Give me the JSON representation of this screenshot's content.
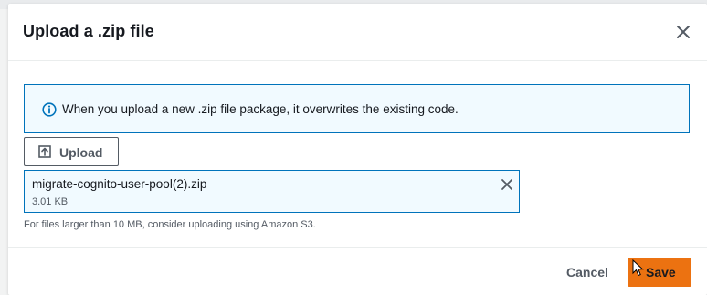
{
  "modal": {
    "title": "Upload a .zip file",
    "close_icon": "close-icon"
  },
  "alert": {
    "type": "info",
    "icon": "info-circle-icon",
    "text": "When you upload a new .zip file package, it overwrites the existing code."
  },
  "upload": {
    "icon": "upload-icon",
    "label": "Upload"
  },
  "file": {
    "name": "migrate-cognito-user-pool(2).zip",
    "size": "3.01 KB",
    "remove_icon": "close-icon"
  },
  "hint": "For files larger than 10 MB, consider uploading using Amazon S3.",
  "footer": {
    "cancel_label": "Cancel",
    "save_label": "Save"
  },
  "colors": {
    "primary_button": "#ec7211",
    "info_border": "#0073bb",
    "info_background": "#f1faff",
    "text": "#16191f",
    "secondary_text": "#545b64"
  }
}
